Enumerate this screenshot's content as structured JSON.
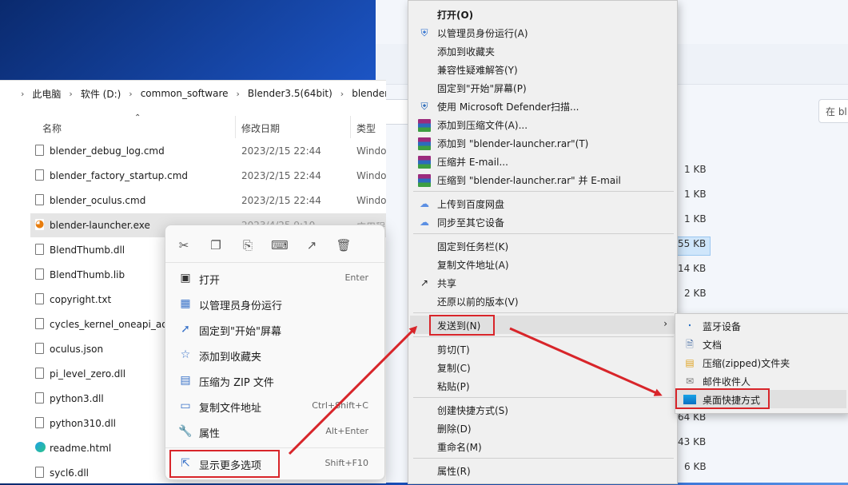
{
  "explorer": {
    "breadcrumb": [
      "此电脑",
      "软件 (D:)",
      "common_software",
      "Blender3.5(64bit)",
      "blender"
    ],
    "columns": {
      "name": "名称",
      "date": "修改日期",
      "type": "类型"
    },
    "files": [
      {
        "name": "blender_debug_log.cmd",
        "date": "2023/2/15 22:44",
        "type": "Windo"
      },
      {
        "name": "blender_factory_startup.cmd",
        "date": "2023/2/15 22:44",
        "type": "Windo"
      },
      {
        "name": "blender_oculus.cmd",
        "date": "2023/2/15 22:44",
        "type": "Windo"
      },
      {
        "name": "blender-launcher.exe",
        "date": "2023/4/25 9:10",
        "type": "应用程"
      },
      {
        "name": "BlendThumb.dll",
        "date": "",
        "type": ""
      },
      {
        "name": "BlendThumb.lib",
        "date": "",
        "type": ""
      },
      {
        "name": "copyright.txt",
        "date": "",
        "type": ""
      },
      {
        "name": "cycles_kernel_oneapi_aot",
        "date": "",
        "type": ""
      },
      {
        "name": "oculus.json",
        "date": "",
        "type": ""
      },
      {
        "name": "pi_level_zero.dll",
        "date": "",
        "type": ""
      },
      {
        "name": "python3.dll",
        "date": "",
        "type": ""
      },
      {
        "name": "python310.dll",
        "date": "",
        "type": ""
      },
      {
        "name": "readme.html",
        "date": "",
        "type": ""
      },
      {
        "name": "sycl6.dll",
        "date": "",
        "type": ""
      }
    ]
  },
  "back_window": {
    "search_placeholder": "在 bl",
    "sizes": [
      "1 KB",
      "1 KB",
      "1 KB",
      "55 KB",
      "14 KB",
      "2 KB",
      "64 KB",
      "43 KB",
      "6 KB"
    ]
  },
  "modern_menu": {
    "items": [
      {
        "label": "打开",
        "shortcut": "Enter"
      },
      {
        "label": "以管理员身份运行",
        "shortcut": ""
      },
      {
        "label": "固定到\"开始\"屏幕",
        "shortcut": ""
      },
      {
        "label": "添加到收藏夹",
        "shortcut": ""
      },
      {
        "label": "压缩为 ZIP 文件",
        "shortcut": ""
      },
      {
        "label": "复制文件地址",
        "shortcut": "Ctrl+Shift+C"
      },
      {
        "label": "属性",
        "shortcut": "Alt+Enter"
      },
      {
        "label": "显示更多选项",
        "shortcut": "Shift+F10"
      }
    ]
  },
  "classic_menu": {
    "items": [
      "打开(O)",
      "以管理员身份运行(A)",
      "添加到收藏夹",
      "兼容性疑难解答(Y)",
      "固定到\"开始\"屏幕(P)",
      "使用 Microsoft Defender扫描...",
      "添加到压缩文件(A)...",
      "添加到 \"blender-launcher.rar\"(T)",
      "压缩并 E-mail...",
      "压缩到 \"blender-launcher.rar\" 并 E-mail",
      "上传到百度网盘",
      "同步至其它设备",
      "固定到任务栏(K)",
      "复制文件地址(A)",
      "共享",
      "还原以前的版本(V)",
      "发送到(N)",
      "剪切(T)",
      "复制(C)",
      "粘贴(P)",
      "创建快捷方式(S)",
      "删除(D)",
      "重命名(M)",
      "属性(R)"
    ]
  },
  "submenu": {
    "items": [
      "蓝牙设备",
      "文档",
      "压缩(zipped)文件夹",
      "邮件收件人",
      "桌面快捷方式"
    ]
  },
  "colors": {
    "highlight": "#d8252a",
    "accent": "#3a73c9"
  }
}
